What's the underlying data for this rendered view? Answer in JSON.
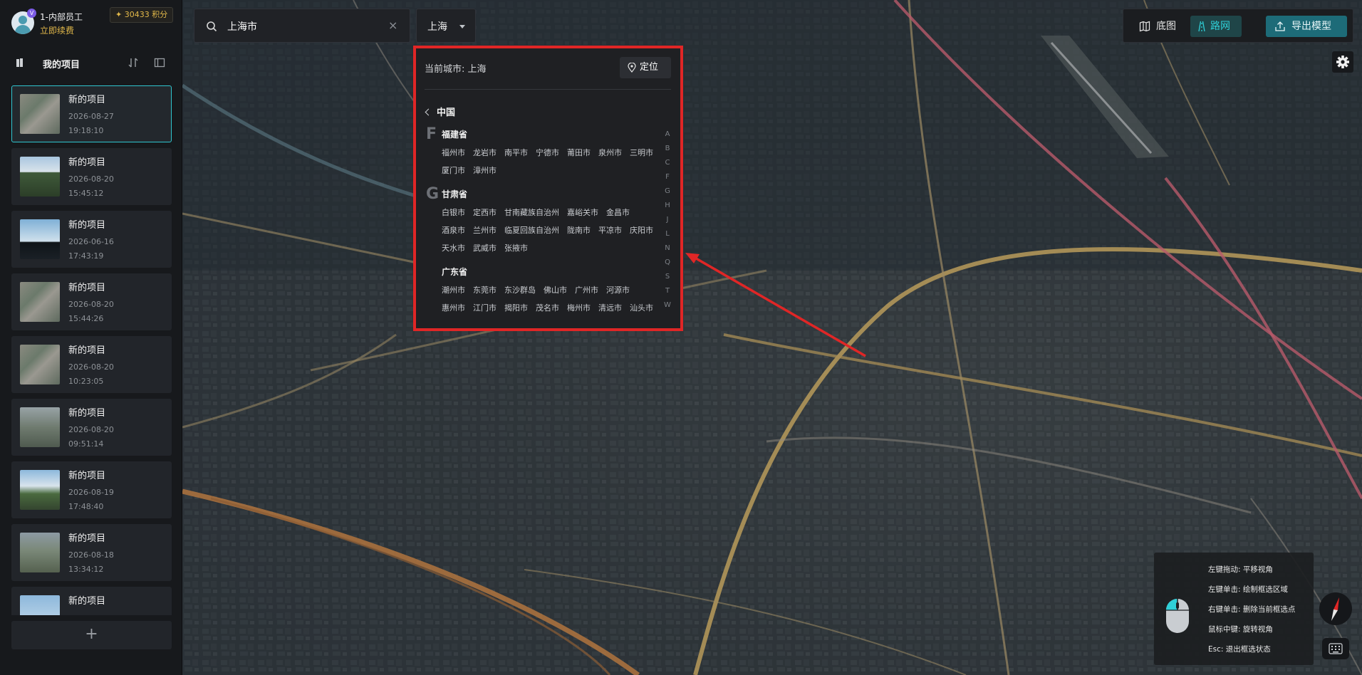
{
  "user": {
    "name": "1-内部员工",
    "renew_label": "立即续费",
    "points": "30433 积分",
    "badge": "V"
  },
  "projects": {
    "title": "我的项目",
    "items": [
      {
        "name": "新的项目",
        "date": "2026-08-27",
        "time": "19:18:10",
        "active": true
      },
      {
        "name": "新的项目",
        "date": "2026-08-20",
        "time": "15:45:12",
        "active": false
      },
      {
        "name": "新的项目",
        "date": "2026-06-16",
        "time": "17:43:19",
        "active": false
      },
      {
        "name": "新的项目",
        "date": "2026-08-20",
        "time": "15:44:26",
        "active": false
      },
      {
        "name": "新的项目",
        "date": "2026-08-20",
        "time": "10:23:05",
        "active": false
      },
      {
        "name": "新的项目",
        "date": "2026-08-20",
        "time": "09:51:14",
        "active": false
      },
      {
        "name": "新的项目",
        "date": "2026-08-19",
        "time": "17:48:40",
        "active": false
      },
      {
        "name": "新的项目",
        "date": "2026-08-18",
        "time": "13:34:12",
        "active": false
      },
      {
        "name": "新的项目",
        "date": "",
        "time": "",
        "active": false
      }
    ],
    "add_label": "+"
  },
  "search": {
    "value": "上海市",
    "clear_label": "×",
    "city_value": "上海"
  },
  "city_panel": {
    "current_label": "当前城市: 上海",
    "locate_label": "定位",
    "country": "中国",
    "groups": [
      {
        "letter": "F",
        "provinces": [
          {
            "name": "福建省",
            "cities": [
              "福州市",
              "龙岩市",
              "南平市",
              "宁德市",
              "莆田市",
              "泉州市",
              "三明市",
              "厦门市",
              "漳州市"
            ]
          }
        ]
      },
      {
        "letter": "G",
        "provinces": [
          {
            "name": "甘肃省",
            "cities": [
              "白银市",
              "定西市",
              "甘南藏族自治州",
              "嘉峪关市",
              "金昌市",
              "酒泉市",
              "兰州市",
              "临夏回族自治州",
              "陇南市",
              "平凉市",
              "庆阳市",
              "天水市",
              "武威市",
              "张掖市"
            ]
          },
          {
            "name": "广东省",
            "cities": [
              "潮州市",
              "东莞市",
              "东沙群岛",
              "佛山市",
              "广州市",
              "河源市",
              "惠州市",
              "江门市",
              "揭阳市",
              "茂名市",
              "梅州市",
              "清远市",
              "汕头市"
            ]
          }
        ]
      }
    ],
    "index_letters": [
      "A",
      "B",
      "C",
      "F",
      "G",
      "H",
      "J",
      "L",
      "N",
      "Q",
      "S",
      "T",
      "W"
    ]
  },
  "toolbar": {
    "basemap_label": "底图",
    "roadnet_label": "路网",
    "export_label": "导出模型"
  },
  "help": {
    "lines": [
      "左键拖动: 平移视角",
      "左键单击: 绘制框选区域",
      "右键单击: 删除当前框选点",
      "鼠标中键: 旋转视角",
      "Esc: 退出框选状态"
    ]
  },
  "colors": {
    "accent": "#2fc6d0",
    "gold": "#e3b94a",
    "highlight_border": "#e02626",
    "export_button": "#1d6b78"
  }
}
